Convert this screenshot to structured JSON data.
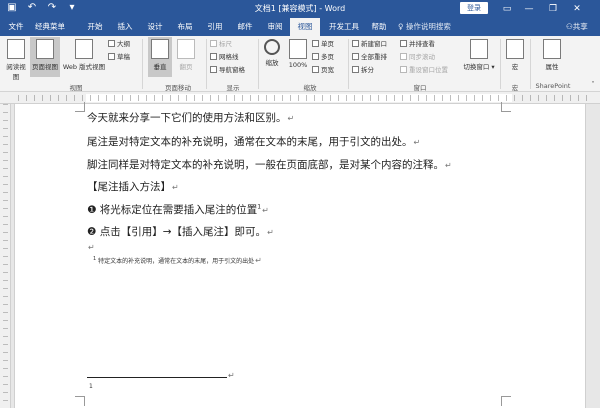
{
  "window": {
    "title": "文档1 [兼容模式] - Word",
    "login_label": "登录",
    "minimize": "—",
    "restore": "❐",
    "close": "✕"
  },
  "qat": {
    "save_icon": "save-icon",
    "undo_icon": "undo-icon",
    "redo_icon": "redo-icon"
  },
  "tabs": [
    "文件",
    "经典菜单",
    "开始",
    "插入",
    "设计",
    "布局",
    "引用",
    "邮件",
    "审阅",
    "视图",
    "开发工具",
    "帮助"
  ],
  "active_tab": "视图",
  "tell_me": "操作说明搜索",
  "share_label": "共享",
  "ribbon": {
    "views": {
      "read_mode": "阅读视图",
      "print_layout": "页面视图",
      "web_layout": "Web 版式视图",
      "outline": "大纲",
      "draft": "草稿",
      "group": "视图"
    },
    "page_movement": {
      "vertical": "垂直",
      "side_to_side": "翻页",
      "group": "页面移动"
    },
    "show": {
      "ruler": "标尺",
      "gridlines": "网格线",
      "nav_pane": "导航窗格",
      "group": "显示"
    },
    "zoom": {
      "zoom": "缩放",
      "percent": "100%",
      "one_page": "单页",
      "multi_page": "多页",
      "page_width": "页宽",
      "group": "缩放"
    },
    "window": {
      "new_window": "新建窗口",
      "arrange_all": "全部重排",
      "split": "拆分",
      "side_by_side": "并排查看",
      "sync_scroll": "同步滚动",
      "reset_pos": "重设窗口位置",
      "switch": "切换窗口",
      "group": "窗口"
    },
    "macros": {
      "macros": "宏",
      "group": "宏"
    },
    "sharepoint": {
      "properties": "属性",
      "group": "SharePoint"
    }
  },
  "document": {
    "lines": [
      "今天就来分享一下它们的使用方法和区别。",
      "尾注是对特定文本的补充说明，通常在文本的末尾，用于引文的出处。",
      "脚注同样是对特定文本的补充说明，一般在页面底部，是对某个内容的注释。",
      "【尾注插入方法】",
      "❶  将光标定位在需要插入尾注的位置",
      "❷  点击【引用】→【插入尾注】即可。"
    ],
    "endnote_marker": "1",
    "endnote_text": "特定文本的补充说明，通常在文本的末尾，用于引文的出处",
    "footnote_marker": "1",
    "paragraph_mark": "↵"
  }
}
